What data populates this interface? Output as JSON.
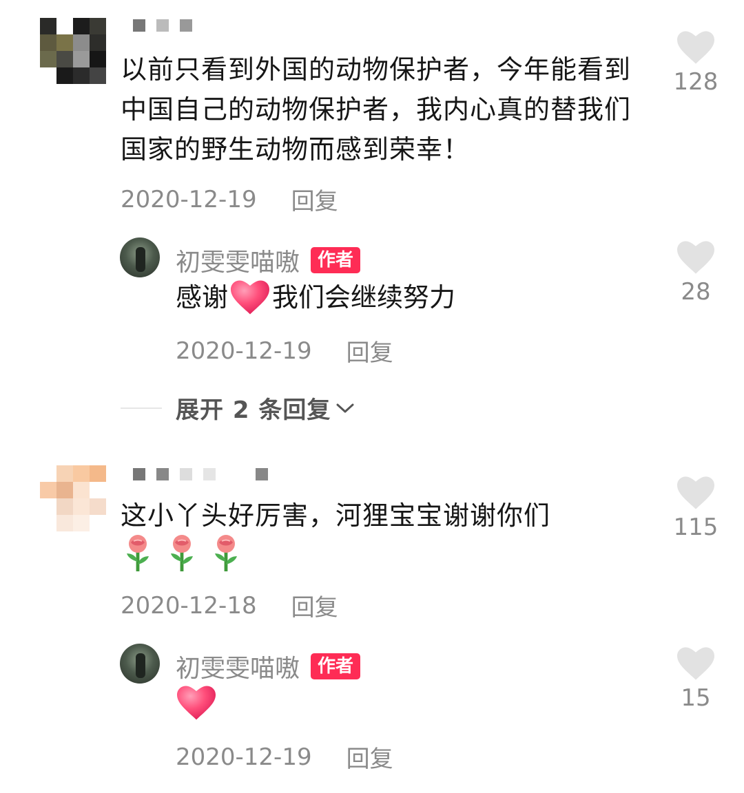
{
  "comments": [
    {
      "text": "以前只看到外国的动物保护者，今年能看到中国自己的动物保护者，我内心真的替我们国家的野生动物而感到荣幸！",
      "date": "2020-12-19",
      "reply_label": "回复",
      "likes": "128",
      "reply": {
        "author": "初雯雯喵嗷",
        "author_tag": "作者",
        "text_before": "感谢",
        "text_after": "我们会继续努力",
        "date": "2020-12-19",
        "reply_label": "回复",
        "likes": "28"
      },
      "expand_label": "展开 2 条回复"
    },
    {
      "text": "这小丫头好厉害，河狸宝宝谢谢你们",
      "date": "2020-12-18",
      "reply_label": "回复",
      "likes": "115",
      "reply": {
        "author": "初雯雯喵嗷",
        "author_tag": "作者",
        "date": "2020-12-19",
        "reply_label": "回复",
        "likes": "15"
      }
    }
  ],
  "colors": {
    "accent": "#fe2c55",
    "meta_gray": "#8a8a8a",
    "like_heart": "#e2e2e2",
    "love_heart": "#ff4f7b"
  }
}
